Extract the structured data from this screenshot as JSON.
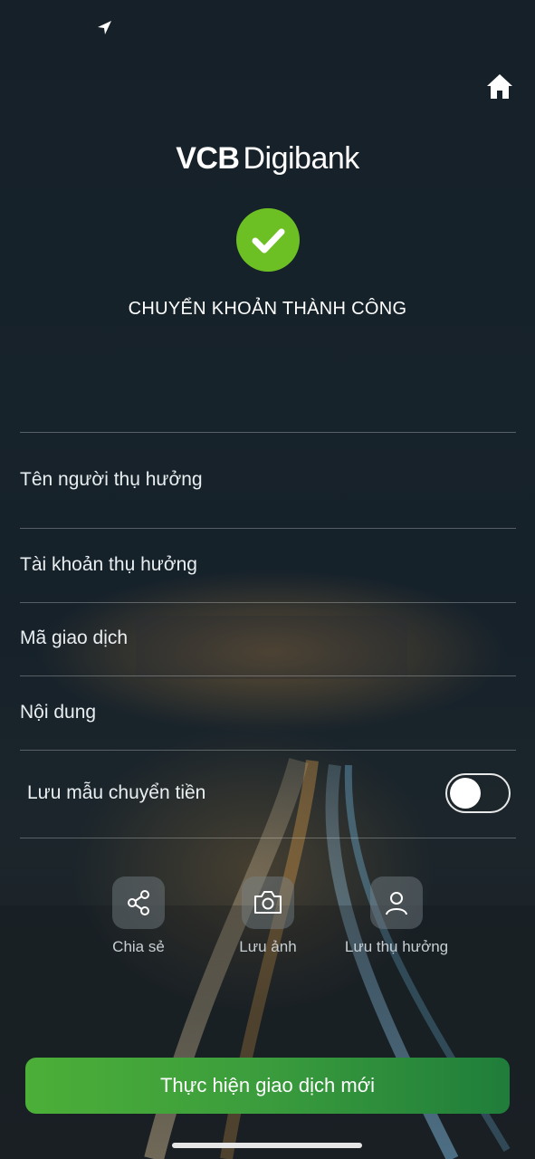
{
  "header": {
    "brand_bold": "VCB",
    "brand_regular": "Digibank"
  },
  "status": {
    "title": "CHUYỂN KHOẢN THÀNH CÔNG"
  },
  "fields": [
    {
      "label": "Tên người thụ hưởng"
    },
    {
      "label": "Tài khoản thụ hưởng"
    },
    {
      "label": "Mã giao dịch"
    },
    {
      "label": "Nội dung"
    }
  ],
  "save_template": {
    "label": "Lưu mẫu chuyển tiền",
    "enabled": false
  },
  "actions": [
    {
      "label": "Chia sẻ",
      "icon": "share-icon"
    },
    {
      "label": "Lưu ảnh",
      "icon": "camera-icon"
    },
    {
      "label": "Lưu thụ hưởng",
      "icon": "user-icon"
    }
  ],
  "primary_button": {
    "label": "Thực hiện giao dịch mới"
  },
  "colors": {
    "success_green": "#6cc024",
    "button_green_start": "#4caf38",
    "button_green_end": "#1f7d3a",
    "background": "#16212a"
  }
}
